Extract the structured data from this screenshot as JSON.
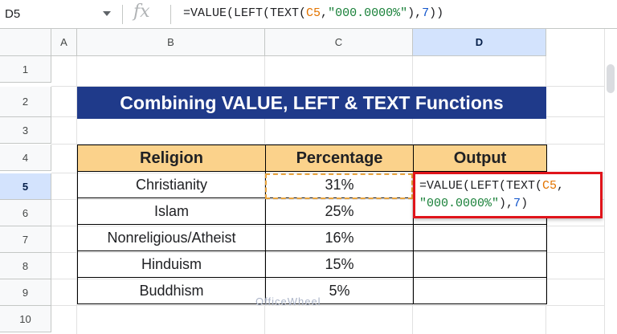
{
  "formula_bar": {
    "name_box": "D5",
    "fx_label": "fx",
    "formula_parts": [
      "=VALUE(LEFT(TEXT(",
      "C5",
      ",",
      "\"000.0000%\"",
      "),",
      "7",
      "))"
    ]
  },
  "columns": [
    "A",
    "B",
    "C",
    "D"
  ],
  "active_column": "D",
  "rows": [
    "1",
    "2",
    "3",
    "4",
    "5",
    "6",
    "7",
    "8",
    "9",
    "10"
  ],
  "active_row": "5",
  "title": "Combining VALUE, LEFT & TEXT Functions",
  "table": {
    "headers": [
      "Religion",
      "Percentage",
      "Output"
    ],
    "rows": [
      [
        "Christianity",
        "31%",
        ""
      ],
      [
        "Islam",
        "25%",
        ""
      ],
      [
        "Nonreligious/Atheist",
        "16%",
        ""
      ],
      [
        "Hinduism",
        "15%",
        ""
      ],
      [
        "Buddhism",
        "5%",
        ""
      ]
    ]
  },
  "edit_cell": {
    "line1_parts": [
      "=VALUE(LEFT(TEXT(",
      "C5",
      ","
    ],
    "line2_parts": [
      "\"000.0000%\"",
      "),",
      "7",
      ")"
    ]
  },
  "watermark": "OfficeWheel",
  "colors": {
    "title_bg": "#1f3a8a",
    "header_bg": "#fbd28b",
    "cell_ref": "#e37400",
    "string_literal": "#188038",
    "number_literal": "#1155cc",
    "edit_border": "#e0141b",
    "copy_border": "#e8a33d"
  }
}
